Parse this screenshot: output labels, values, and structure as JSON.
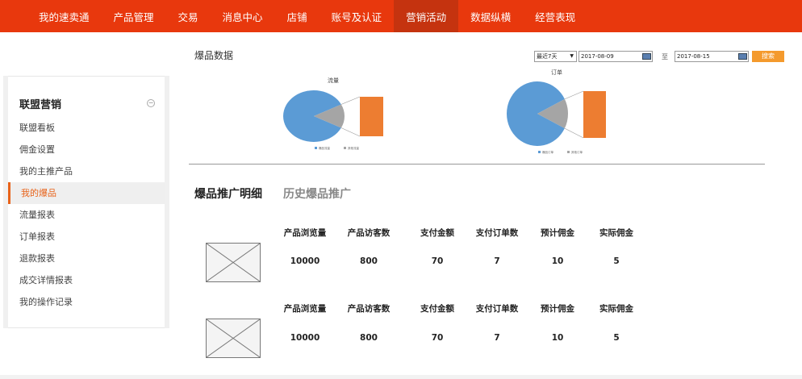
{
  "nav": {
    "items": [
      {
        "label": "我的速卖通",
        "active": false
      },
      {
        "label": "产品管理",
        "active": false
      },
      {
        "label": "交易",
        "active": false
      },
      {
        "label": "消息中心",
        "active": false
      },
      {
        "label": "店铺",
        "active": false
      },
      {
        "label": "账号及认证",
        "active": false
      },
      {
        "label": "营销活动",
        "active": true
      },
      {
        "label": "数据纵横",
        "active": false
      },
      {
        "label": "经营表现",
        "active": false
      }
    ]
  },
  "sidebar": {
    "title": "联盟营销",
    "toggle_icon": "−",
    "items": [
      {
        "label": "联盟看板",
        "active": false
      },
      {
        "label": "佣金设置",
        "active": false
      },
      {
        "label": "我的主推产品",
        "active": false
      },
      {
        "label": "我的爆品",
        "active": true
      },
      {
        "label": "流量报表",
        "active": false
      },
      {
        "label": "订单报表",
        "active": false
      },
      {
        "label": "退款报表",
        "active": false
      },
      {
        "label": "成交详情报表",
        "active": false
      },
      {
        "label": "我的操作记录",
        "active": false
      }
    ]
  },
  "section_title": "爆品数据",
  "filters": {
    "range_select": "最近7天",
    "date_from": "2017-08-09",
    "to_label": "至",
    "date_to": "2017-08-15",
    "search_button": "搜索"
  },
  "chart_data": [
    {
      "type": "pie",
      "title": "流量",
      "slices": [
        {
          "label": "爆品流量",
          "value": 0.85,
          "color": "#5b9bd5"
        },
        {
          "label": "其他流量",
          "value": 0.15,
          "color": "#a5a5a5"
        }
      ],
      "breakout_color": "#ed7d31"
    },
    {
      "type": "pie",
      "title": "订单",
      "slices": [
        {
          "label": "爆品订单",
          "value": 0.85,
          "color": "#5b9bd5"
        },
        {
          "label": "其他订单",
          "value": 0.15,
          "color": "#a5a5a5"
        }
      ],
      "breakout_color": "#ed7d31"
    }
  ],
  "tabs": {
    "active": "爆品推广明细",
    "inactive": "历史爆品推广"
  },
  "table": {
    "headers": [
      "产品浏览量",
      "产品访客数",
      "支付金额",
      "支付订单数",
      "预计佣金",
      "实际佣金"
    ],
    "rows": [
      [
        "10000",
        "800",
        "70",
        "7",
        "10",
        "5"
      ],
      [
        "10000",
        "800",
        "70",
        "7",
        "10",
        "5"
      ]
    ]
  }
}
